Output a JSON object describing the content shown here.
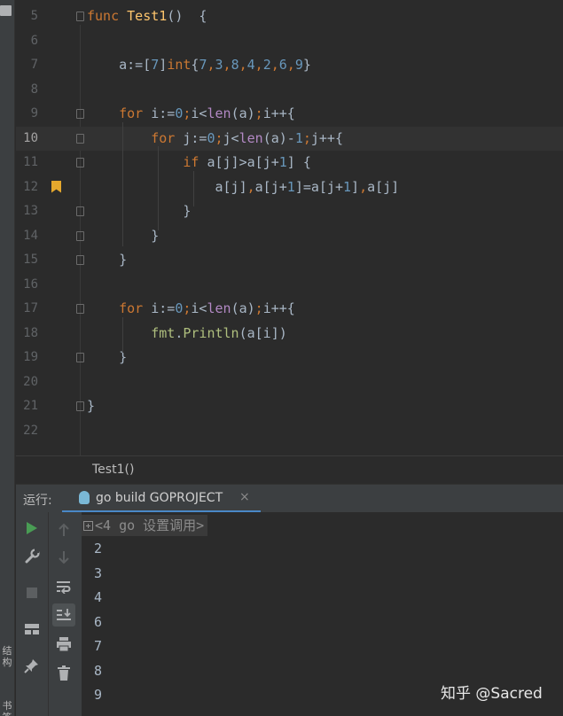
{
  "sidebar": {
    "structure_label": "结构",
    "bookmarks_label": "书签"
  },
  "editor": {
    "current_line": 10,
    "lines": [
      {
        "n": "5",
        "tokens": [
          {
            "t": "func ",
            "c": "kw"
          },
          {
            "t": "Test1",
            "c": "fn"
          },
          {
            "t": "()  {",
            "c": ""
          }
        ]
      },
      {
        "n": "6",
        "tokens": []
      },
      {
        "n": "7",
        "tokens": [
          {
            "t": "    a:=[",
            "c": ""
          },
          {
            "t": "7",
            "c": "num"
          },
          {
            "t": "]",
            "c": ""
          },
          {
            "t": "int",
            "c": "kw"
          },
          {
            "t": "{",
            "c": ""
          },
          {
            "t": "7",
            "c": "num"
          },
          {
            "t": ",",
            "c": "kw"
          },
          {
            "t": "3",
            "c": "num"
          },
          {
            "t": ",",
            "c": "kw"
          },
          {
            "t": "8",
            "c": "num"
          },
          {
            "t": ",",
            "c": "kw"
          },
          {
            "t": "4",
            "c": "num"
          },
          {
            "t": ",",
            "c": "kw"
          },
          {
            "t": "2",
            "c": "num"
          },
          {
            "t": ",",
            "c": "kw"
          },
          {
            "t": "6",
            "c": "num"
          },
          {
            "t": ",",
            "c": "kw"
          },
          {
            "t": "9",
            "c": "num"
          },
          {
            "t": "}",
            "c": ""
          }
        ]
      },
      {
        "n": "8",
        "tokens": []
      },
      {
        "n": "9",
        "tokens": [
          {
            "t": "    ",
            "c": ""
          },
          {
            "t": "for ",
            "c": "kw"
          },
          {
            "t": "i:=",
            "c": ""
          },
          {
            "t": "0",
            "c": "num"
          },
          {
            "t": ";",
            "c": "kw"
          },
          {
            "t": "i<",
            "c": ""
          },
          {
            "t": "len",
            "c": "bi"
          },
          {
            "t": "(a)",
            "c": ""
          },
          {
            "t": ";",
            "c": "kw"
          },
          {
            "t": "i++{",
            "c": ""
          }
        ]
      },
      {
        "n": "10",
        "tokens": [
          {
            "t": "        ",
            "c": ""
          },
          {
            "t": "for ",
            "c": "kw"
          },
          {
            "t": "j:=",
            "c": ""
          },
          {
            "t": "0",
            "c": "num"
          },
          {
            "t": ";",
            "c": "kw"
          },
          {
            "t": "j<",
            "c": ""
          },
          {
            "t": "len",
            "c": "bi"
          },
          {
            "t": "(a)-",
            "c": ""
          },
          {
            "t": "1",
            "c": "num"
          },
          {
            "t": ";",
            "c": "kw"
          },
          {
            "t": "j++{",
            "c": ""
          }
        ]
      },
      {
        "n": "11",
        "tokens": [
          {
            "t": "            ",
            "c": ""
          },
          {
            "t": "if ",
            "c": "kw"
          },
          {
            "t": "a[j]>a[j+",
            "c": ""
          },
          {
            "t": "1",
            "c": "num"
          },
          {
            "t": "] {",
            "c": ""
          }
        ]
      },
      {
        "n": "12",
        "tokens": [
          {
            "t": "                a[j]",
            "c": ""
          },
          {
            "t": ",",
            "c": "kw"
          },
          {
            "t": "a[j+",
            "c": ""
          },
          {
            "t": "1",
            "c": "num"
          },
          {
            "t": "]=a[j+",
            "c": ""
          },
          {
            "t": "1",
            "c": "num"
          },
          {
            "t": "]",
            "c": ""
          },
          {
            "t": ",",
            "c": "kw"
          },
          {
            "t": "a[j]",
            "c": ""
          }
        ]
      },
      {
        "n": "13",
        "tokens": [
          {
            "t": "            }",
            "c": ""
          }
        ]
      },
      {
        "n": "14",
        "tokens": [
          {
            "t": "        }",
            "c": ""
          }
        ]
      },
      {
        "n": "15",
        "tokens": [
          {
            "t": "    }",
            "c": ""
          }
        ]
      },
      {
        "n": "16",
        "tokens": []
      },
      {
        "n": "17",
        "tokens": [
          {
            "t": "    ",
            "c": ""
          },
          {
            "t": "for ",
            "c": "kw"
          },
          {
            "t": "i:=",
            "c": ""
          },
          {
            "t": "0",
            "c": "num"
          },
          {
            "t": ";",
            "c": "kw"
          },
          {
            "t": "i<",
            "c": ""
          },
          {
            "t": "len",
            "c": "bi"
          },
          {
            "t": "(a)",
            "c": ""
          },
          {
            "t": ";",
            "c": "kw"
          },
          {
            "t": "i++{",
            "c": ""
          }
        ]
      },
      {
        "n": "18",
        "tokens": [
          {
            "t": "        ",
            "c": ""
          },
          {
            "t": "fmt",
            "c": "pk"
          },
          {
            "t": ".",
            "c": ""
          },
          {
            "t": "Println",
            "c": "pk"
          },
          {
            "t": "(a[i])",
            "c": ""
          }
        ]
      },
      {
        "n": "19",
        "tokens": [
          {
            "t": "    }",
            "c": ""
          }
        ]
      },
      {
        "n": "20",
        "tokens": []
      },
      {
        "n": "21",
        "tokens": [
          {
            "t": "}",
            "c": ""
          }
        ]
      },
      {
        "n": "22",
        "tokens": []
      }
    ]
  },
  "breadcrumb": {
    "function": "Test1()"
  },
  "run_panel": {
    "label": "运行:",
    "tab_title": "go build GOPROJECT",
    "close_glyph": "×",
    "console_header": "<4 go 设置调用>",
    "output": [
      "2",
      "3",
      "4",
      "6",
      "7",
      "8",
      "9"
    ]
  },
  "watermark": "知乎 @Sacred",
  "colors": {
    "keyword": "#cc7832",
    "function": "#ffc66d",
    "number": "#6897bb",
    "builtin": "#b389c5",
    "package": "#afbf7e",
    "run_icon": "#499c54",
    "bookmark": "#e5a82d"
  }
}
